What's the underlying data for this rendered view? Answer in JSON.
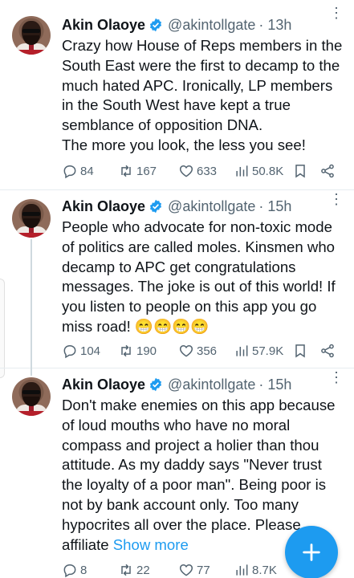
{
  "tweets": [
    {
      "name": "Akin Olaoye",
      "handle": "@akintollgate",
      "time": "· 13h",
      "text": "Crazy how House of Reps members in the South East were the first to decamp to the much hated APC. Ironically, LP members in the South West have kept a true semblance of opposition DNA.\nThe more you look, the less you see!",
      "show_more": "",
      "replies": "84",
      "retweets": "167",
      "likes": "633",
      "views": "50.8K"
    },
    {
      "name": "Akin Olaoye",
      "handle": "@akintollgate",
      "time": "· 15h",
      "text": "People who advocate for non-toxic mode of politics are called moles. Kinsmen who decamp to APC get congratulations messages. The joke is out of this world! If you listen to people on this app you go miss road! 😁😁😁😁",
      "show_more": "",
      "replies": "104",
      "retweets": "190",
      "likes": "356",
      "views": "57.9K"
    },
    {
      "name": "Akin Olaoye",
      "handle": "@akintollgate",
      "time": "· 15h",
      "text": "Don't make enemies on this app because of loud mouths who have no moral compass and project a holier than thou attitude. As my daddy says \"Never trust the loyalty of a poor man\". Being poor is not by bank account only. Too many hypocrites all over the place. Please affiliate ",
      "show_more": "Show more",
      "replies": "8",
      "retweets": "22",
      "likes": "77",
      "views": "8.7K"
    }
  ],
  "icons": {
    "verified": "verified-badge-icon",
    "more": "more-options-icon",
    "reply": "reply-icon",
    "retweet": "retweet-icon",
    "like": "like-icon",
    "views": "views-icon",
    "bookmark": "bookmark-icon",
    "share": "share-icon",
    "compose": "compose-plus-icon"
  },
  "colors": {
    "accent": "#1d9bf0",
    "muted": "#536471",
    "text": "#0f1419"
  }
}
